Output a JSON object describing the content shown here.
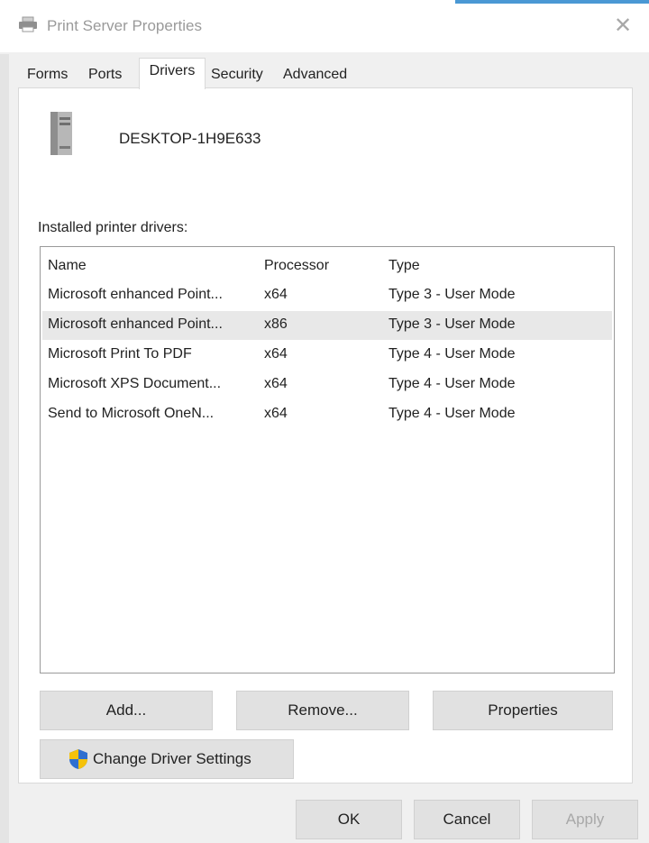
{
  "window": {
    "title": "Print Server Properties",
    "close_glyph": "✕"
  },
  "tabs": [
    {
      "label": "Forms"
    },
    {
      "label": "Ports"
    },
    {
      "label": "Drivers",
      "active": true
    },
    {
      "label": "Security"
    },
    {
      "label": "Advanced"
    }
  ],
  "server": {
    "name": "DESKTOP-1H9E633",
    "icon": "server-tower-icon"
  },
  "drivers": {
    "label": "Installed printer drivers:",
    "columns": [
      "Name",
      "Processor",
      "Type"
    ],
    "rows": [
      {
        "name": "Microsoft enhanced Point...",
        "processor": "x64",
        "type": "Type 3 - User Mode",
        "selected": false
      },
      {
        "name": "Microsoft enhanced Point...",
        "processor": "x86",
        "type": "Type 3 - User Mode",
        "selected": true
      },
      {
        "name": "Microsoft Print To PDF",
        "processor": "x64",
        "type": "Type 4 - User Mode",
        "selected": false
      },
      {
        "name": "Microsoft XPS Document...",
        "processor": "x64",
        "type": "Type 4 - User Mode",
        "selected": false
      },
      {
        "name": "Send to Microsoft OneN...",
        "processor": "x64",
        "type": "Type 4 - User Mode",
        "selected": false
      }
    ]
  },
  "buttons": {
    "add": "Add...",
    "remove": "Remove...",
    "properties": "Properties",
    "change_driver_settings": "Change Driver Settings",
    "ok": "OK",
    "cancel": "Cancel",
    "apply": "Apply"
  },
  "colors": {
    "accent": "#4a98d4",
    "shield_blue": "#2f6fd0",
    "shield_yellow": "#f5c20a"
  }
}
